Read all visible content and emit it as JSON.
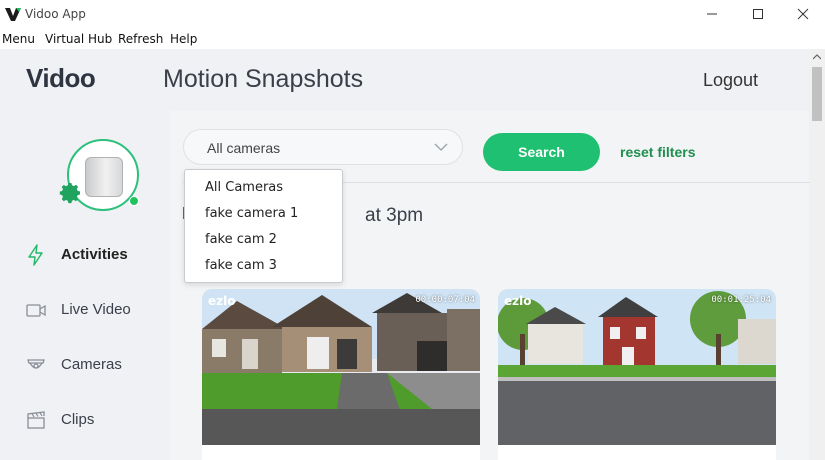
{
  "window": {
    "title": "Vidoo App",
    "minimize_glyph": "—",
    "maximize_glyph": "☐",
    "close_glyph": "✕"
  },
  "menubar": {
    "items": [
      "Menu",
      "Virtual Hub",
      "Refresh",
      "Help"
    ]
  },
  "header": {
    "brand": "Vidoo",
    "title": "Motion Snapshots",
    "logout_label": "Logout"
  },
  "sidebar": {
    "items": [
      {
        "label": "Activities",
        "icon": "lightning-icon",
        "active": true
      },
      {
        "label": "Live Video",
        "icon": "video-camera-icon",
        "active": false
      },
      {
        "label": "Cameras",
        "icon": "security-camera-icon",
        "active": false
      },
      {
        "label": "Clips",
        "icon": "clapperboard-icon",
        "active": false
      }
    ],
    "status": "online"
  },
  "filters": {
    "camera_select_value": "All cameras",
    "search_label": "Search",
    "reset_label": "reset filters",
    "dropdown_options": [
      "All Cameras",
      "fake camera 1",
      "fake cam 2",
      "fake cam 3"
    ]
  },
  "content": {
    "date_heading_visible": "at 3pm"
  },
  "snapshots": [
    {
      "brand": "ezlo",
      "timestamp": "00:00:07:04"
    },
    {
      "brand": "ezlo",
      "timestamp": "00:01:25:04"
    }
  ],
  "colors": {
    "accent_green": "#20c072",
    "link_green": "#1f8f4e",
    "header_bg": "#f0f1f4"
  }
}
